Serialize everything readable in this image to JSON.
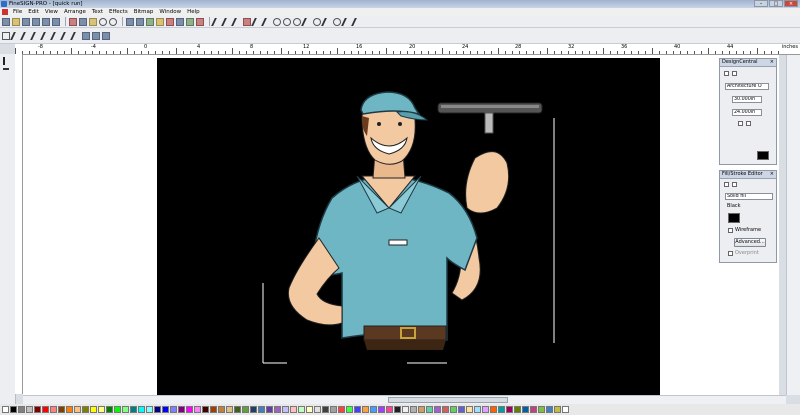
{
  "window": {
    "title": "FineSIGN-PRO - [quick run]",
    "buttons": [
      "–",
      "□",
      "×"
    ]
  },
  "menu": [
    "File",
    "Edit",
    "View",
    "Arrange",
    "Text",
    "Effects",
    "Bitmap",
    "Window",
    "Help"
  ],
  "ruler": {
    "labels": [
      "-8",
      "-4",
      "0",
      "4",
      "8",
      "12",
      "16",
      "20",
      "24",
      "28",
      "32",
      "36",
      "40",
      "44"
    ],
    "unit": "inches"
  },
  "design_central": {
    "title": "DesignCentral",
    "font": "Architecture O",
    "width": "30.000in",
    "height": "24.000in"
  },
  "fill_stroke": {
    "title": "Fill/Stroke Editor",
    "fill_type": "Solid fill",
    "color_name": "Black",
    "wireframe": "Wireframe",
    "advanced": "Advanced...",
    "overprint": "Overprint"
  },
  "palette": {
    "colors": [
      "#ffffff",
      "#000000",
      "#808080",
      "#c0c0c0",
      "#800000",
      "#ff0000",
      "#ff8080",
      "#804000",
      "#ff8000",
      "#ffc080",
      "#808000",
      "#ffff00",
      "#ffff80",
      "#008000",
      "#00ff00",
      "#80ff80",
      "#008080",
      "#00ffff",
      "#80ffff",
      "#000080",
      "#0000ff",
      "#8080ff",
      "#800080",
      "#ff00ff",
      "#ff80ff",
      "#400000",
      "#a04000",
      "#c08040",
      "#e0c080",
      "#406020",
      "#60a040",
      "#204060",
      "#4080c0",
      "#6040a0",
      "#a060c0",
      "#c0c0ff",
      "#ffc0c0",
      "#c0ffc0",
      "#ffffc0",
      "#e0e0e0",
      "#404040",
      "#a0a0a0",
      "#ff4040",
      "#40ff40",
      "#4040ff",
      "#ffa040",
      "#40a0ff",
      "#a040ff",
      "#ff40a0",
      "#202020",
      "#f0f0f0",
      "#b0b0b0",
      "#d0a060",
      "#60d0a0",
      "#a060d0",
      "#d06060",
      "#60d060",
      "#6060d0",
      "#ffe0a0",
      "#a0e0ff",
      "#e0a0ff",
      "#ff6000",
      "#00a0a0",
      "#a00060",
      "#608000",
      "#0060a0",
      "#c04080",
      "#80c040",
      "#4080c0",
      "#c0c040",
      "#ffffff"
    ]
  }
}
